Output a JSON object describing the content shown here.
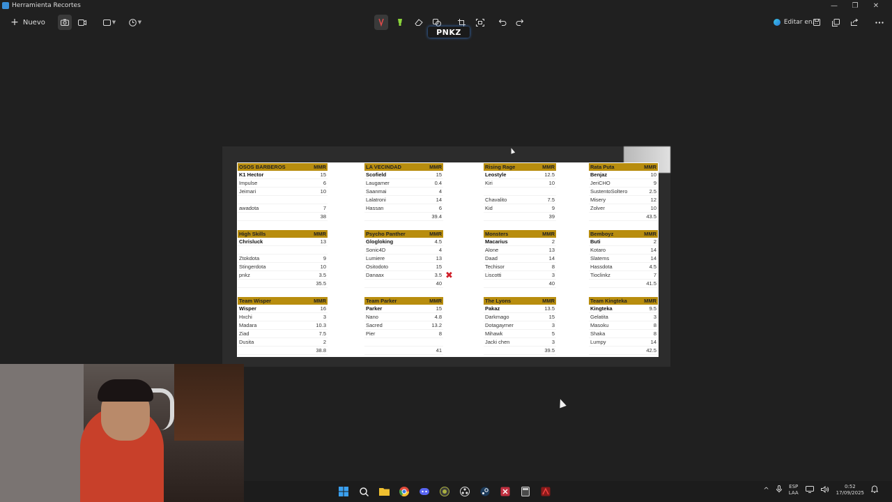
{
  "window": {
    "title": "Herramienta Recortes",
    "controls": [
      "—",
      "❐",
      "✕"
    ]
  },
  "toolbar": {
    "new_label": "Nuevo",
    "edit_label": "Editar en...",
    "icons": [
      "camera-icon",
      "video-icon",
      "rectangle-mode-icon",
      "timer-icon",
      "ballpoint-pen-icon",
      "highlighter-icon",
      "eraser-icon",
      "shapes-icon",
      "crop-icon",
      "text-actions-icon",
      "undo-icon",
      "redo-icon",
      "save-icon",
      "copy-icon",
      "share-icon",
      "more-icon"
    ]
  },
  "overlay_text": "PNKZ",
  "sheet": {
    "mmr_label": "MMR",
    "teams": [
      {
        "name": "OSOS BARBEROS",
        "players": [
          [
            "K1 Hector",
            "15"
          ],
          [
            "Impulse",
            "6"
          ],
          [
            "Jeimari",
            "10"
          ],
          [
            "",
            ""
          ],
          [
            "awadota",
            "7"
          ],
          [
            "",
            "38"
          ]
        ]
      },
      {
        "name": "LA VECINDAD",
        "players": [
          [
            "Scofield",
            "15"
          ],
          [
            "Laugamer",
            "0.4"
          ],
          [
            "Saanmai",
            "4"
          ],
          [
            "Lalatroni",
            "14"
          ],
          [
            "Hassan",
            "6"
          ],
          [
            "",
            "39.4"
          ]
        ]
      },
      {
        "name": "Rising Rage",
        "players": [
          [
            "Leostyle",
            "12.5"
          ],
          [
            "Kiri",
            "10"
          ],
          [
            "",
            ""
          ],
          [
            "Chavalito",
            "7.5"
          ],
          [
            "Kid",
            "9"
          ],
          [
            "",
            "39"
          ]
        ]
      },
      {
        "name": "Rata Puta",
        "players": [
          [
            "Benjaz",
            "10"
          ],
          [
            "JeriCHO",
            "9"
          ],
          [
            "SustentoSoltero",
            "2.5"
          ],
          [
            "Misery",
            "12"
          ],
          [
            "Zolver",
            "10"
          ],
          [
            "",
            "43.5"
          ]
        ]
      },
      {
        "name": "High Skills",
        "players": [
          [
            "Chrisluck",
            "13"
          ],
          [
            "",
            ""
          ],
          [
            "Ztokdota",
            "9"
          ],
          [
            "Stingerdota",
            "10"
          ],
          [
            "pnkz",
            "3.5"
          ],
          [
            "",
            "35.5"
          ]
        ]
      },
      {
        "name": "Psycho Panther",
        "players": [
          [
            "Glogloking",
            "4.5"
          ],
          [
            "Sonic4D",
            "4"
          ],
          [
            "Lumiere",
            "13"
          ],
          [
            "Ositodoto",
            "15"
          ],
          [
            "Danaax",
            "3.5"
          ],
          [
            "",
            "40"
          ]
        ]
      },
      {
        "name": "Monsters",
        "players": [
          [
            "Macarius",
            "2"
          ],
          [
            "Alone",
            "13"
          ],
          [
            "Daad",
            "14"
          ],
          [
            "Techisor",
            "8"
          ],
          [
            "Liscotti",
            "3"
          ],
          [
            "",
            "40"
          ]
        ]
      },
      {
        "name": "Bemboyz",
        "players": [
          [
            "Buti",
            "2"
          ],
          [
            "Kotaro",
            "14"
          ],
          [
            "Slatems",
            "14"
          ],
          [
            "Hassdota",
            "4.5"
          ],
          [
            "Tioclinkz",
            "7"
          ],
          [
            "",
            "41.5"
          ]
        ]
      },
      {
        "name": "Team Wisper",
        "players": [
          [
            "Wisper",
            "16"
          ],
          [
            "Hxchi",
            "3"
          ],
          [
            "Madara",
            "10.3"
          ],
          [
            "Ziad",
            "7.5"
          ],
          [
            "Dusita",
            "2"
          ],
          [
            "",
            "38.8"
          ]
        ]
      },
      {
        "name": "Team Parker",
        "players": [
          [
            "Parker",
            "15"
          ],
          [
            "Nano",
            "4.8"
          ],
          [
            "Sacred",
            "13.2"
          ],
          [
            "Pier",
            "8"
          ],
          [
            "",
            ""
          ],
          [
            "",
            "41"
          ]
        ]
      },
      {
        "name": "The Lyons",
        "players": [
          [
            "Pakaz",
            "13.5"
          ],
          [
            "Darkmago",
            "15"
          ],
          [
            "Dotagaymer",
            "3"
          ],
          [
            "Mihawk",
            "5"
          ],
          [
            "Jacki chen",
            "3"
          ],
          [
            "",
            "39.5"
          ]
        ]
      },
      {
        "name": "Team Kingteka",
        "players": [
          [
            "Kingteka",
            "9.5"
          ],
          [
            "Gelatita",
            "3"
          ],
          [
            "Masoku",
            "8"
          ],
          [
            "Shaka",
            "8"
          ],
          [
            "Lumpy",
            "14"
          ],
          [
            "",
            "42.5"
          ]
        ]
      }
    ]
  },
  "taskbar": {
    "apps": [
      "windows-start-icon",
      "search-icon",
      "file-explorer-icon",
      "chrome-icon",
      "discord-icon",
      "app-icon",
      "obs-icon",
      "steam-icon",
      "snipping-tool-icon",
      "calculator-icon",
      "app-red-icon"
    ],
    "lang_top": "ESP",
    "lang_bottom": "LAA",
    "time": "0:52",
    "date": "17/09/2025"
  }
}
